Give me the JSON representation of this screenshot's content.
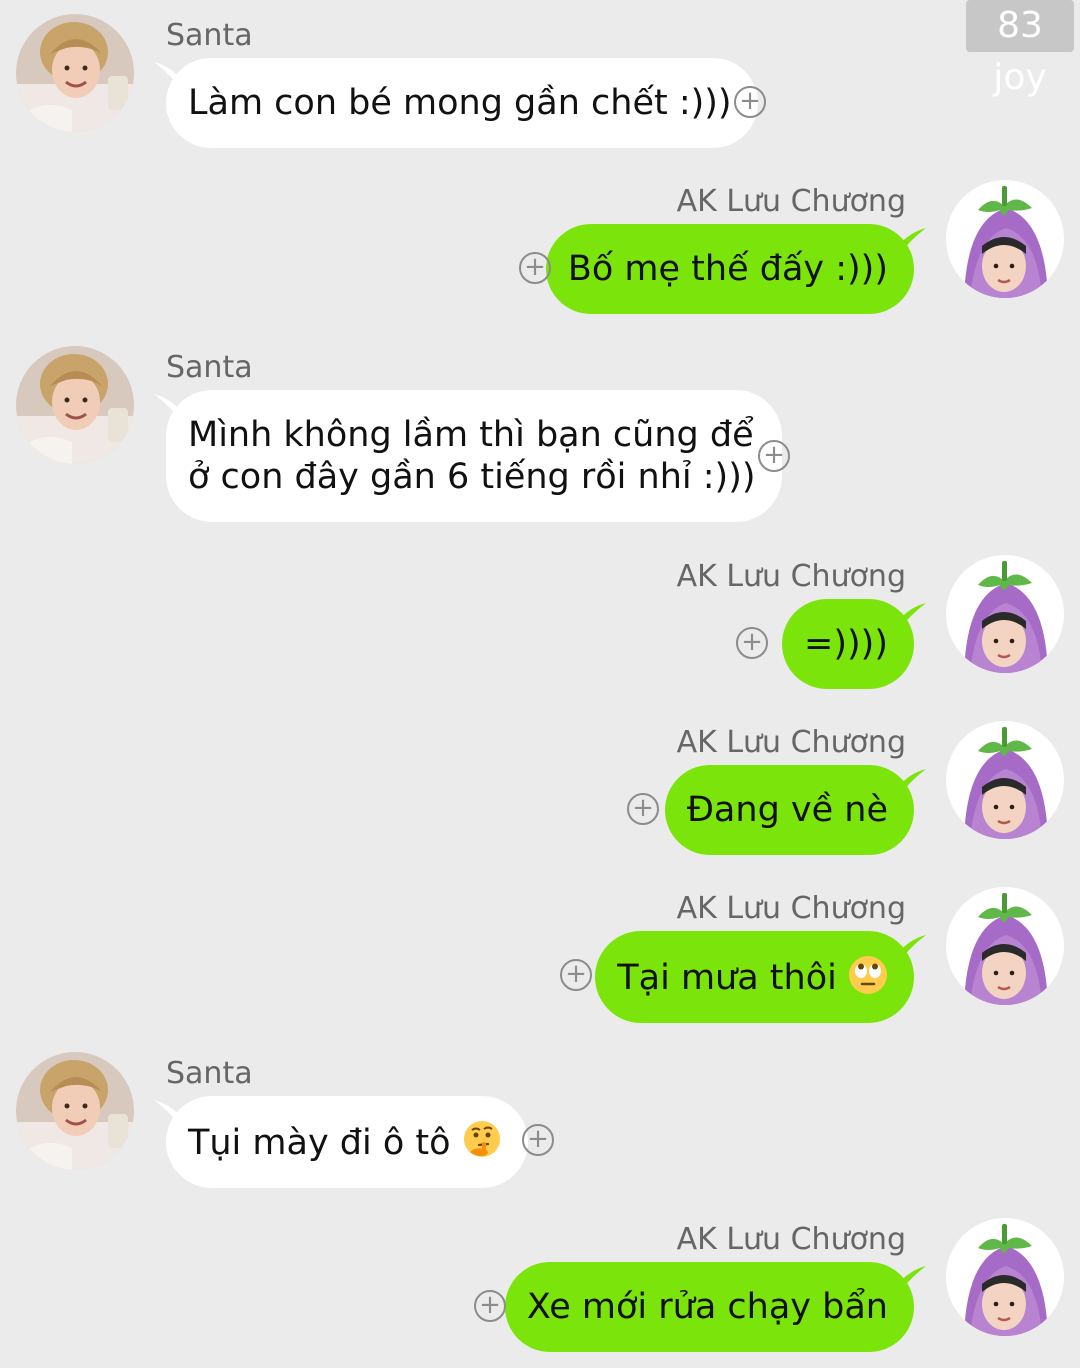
{
  "watermark": "83 joy",
  "contacts": {
    "santa": {
      "name": "Santa",
      "avatar_icon": "santa-avatar"
    },
    "ak": {
      "name": "AK Lưu Chương",
      "avatar_icon": "eggplant-hat-avatar"
    }
  },
  "messages": [
    {
      "sender": "Santa",
      "side": "incoming",
      "text": "Làm con bé mong gần chết :)))"
    },
    {
      "sender": "AK Lưu Chương",
      "side": "outgoing",
      "text": "Bố mẹ thế đấy :)))"
    },
    {
      "sender": "Santa",
      "side": "incoming",
      "text": "Mình không lầm thì bạn cũng để\nở con đây gần 6 tiếng rồi nhỉ :)))"
    },
    {
      "sender": "AK Lưu Chương",
      "side": "outgoing",
      "text": "=))))"
    },
    {
      "sender": "AK Lưu Chương",
      "side": "outgoing",
      "text": "Đang về nè"
    },
    {
      "sender": "AK Lưu Chương",
      "side": "outgoing",
      "text": "Tại mưa thôi",
      "emoji": "eye-roll-emoji"
    },
    {
      "sender": "Santa",
      "side": "incoming",
      "text": "Tụi mày đi ô tô",
      "emoji": "thinking-face-emoji"
    },
    {
      "sender": "AK Lưu Chương",
      "side": "outgoing",
      "text": "Xe mới rửa chạy bẩn"
    }
  ],
  "add_button_symbol": "+",
  "colors": {
    "background": "#ebebeb",
    "incoming_bubble": "#ffffff",
    "outgoing_bubble": "#7ae40b",
    "sender_text": "#666666"
  }
}
